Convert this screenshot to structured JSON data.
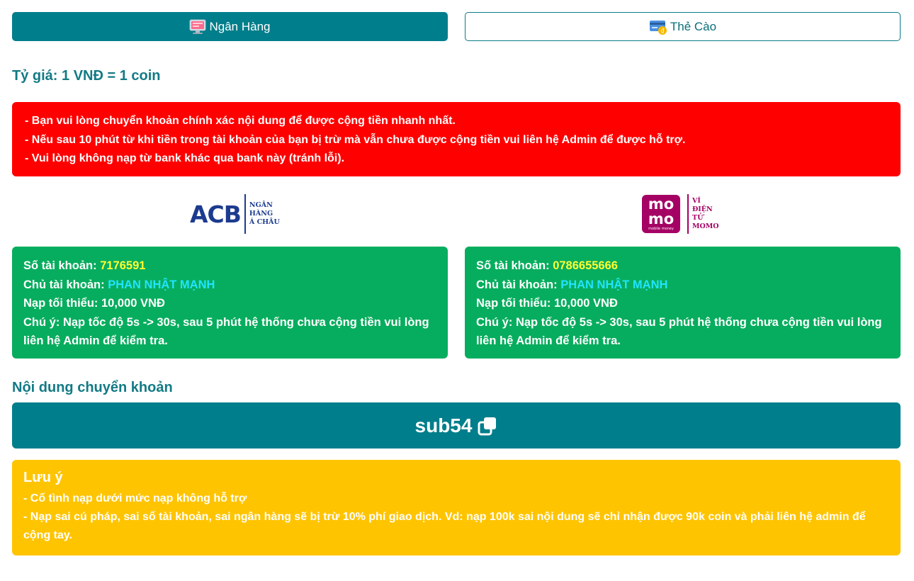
{
  "tabs": {
    "bank_label": "Ngân Hàng",
    "card_label": "Thẻ Cào"
  },
  "rate_text": "Tỷ giá: 1 VNĐ = 1 coin",
  "warning": {
    "lines": [
      "- Bạn vui lòng chuyển khoản chính xác nội dung để được cộng tiền nhanh nhất.",
      "- Nếu sau 10 phút từ khi tiền trong tài khoản của bạn bị trừ mà vẫn chưa được cộng tiền vui liên hệ Admin để được hỗ trợ.",
      "- Vui lòng không nạp từ bank khác qua bank này (tránh lỗi)."
    ]
  },
  "banks": [
    {
      "logo_word": "ACB",
      "logo_sub": [
        "NGÂN",
        "HÀNG",
        "Á CHÂU"
      ],
      "account_label": "Số tài khoản:",
      "account_number": "7176591",
      "owner_label": "Chủ tài khoản:",
      "owner_name": "PHAN NHẬT MẠNH",
      "min_label": "Nạp tối thiểu:",
      "min_value": "10,000 VNĐ",
      "note_label": "Chú ý:",
      "note_text": "Nạp tốc độ 5s -> 30s, sau 5 phút hệ thống chưa cộng tiền vui lòng liên hệ Admin để kiểm tra."
    },
    {
      "logo_word_top": "mo",
      "logo_word_bottom": "mo",
      "logo_small": "mobile money",
      "logo_sub": [
        "VÍ",
        "ĐIỆN",
        "TỬ",
        "MOMO"
      ],
      "account_label": "Số tài khoản:",
      "account_number": "0786655666",
      "owner_label": "Chủ tài khoản:",
      "owner_name": "PHAN NHẬT MẠNH",
      "min_label": "Nạp tối thiểu:",
      "min_value": "10,000 VNĐ",
      "note_label": "Chú ý:",
      "note_text": "Nạp tốc độ 5s -> 30s, sau 5 phút hệ thống chưa cộng tiền vui lòng liên hệ Admin để kiểm tra."
    }
  ],
  "transfer": {
    "title": "Nội dung chuyển khoản",
    "code": "sub54"
  },
  "notice": {
    "title": "Lưu ý",
    "lines": [
      "- Cố tình nạp dưới mức nạp không hỗ trợ",
      "- Nạp sai cú pháp, sai số tài khoản, sai ngân hàng sẽ bị trừ 10% phí giao dịch. Vd: nạp 100k sai nội dung sẽ chỉ nhận được 90k coin và phải liên hệ admin để cộng tay."
    ]
  },
  "colors": {
    "teal": "#007e8b",
    "red": "#ff0000",
    "green": "#07ad5e",
    "yellow": "#ffc400",
    "acb_blue": "#1c3b8f",
    "momo_pink": "#a50064"
  },
  "icons": [
    "bank-computer-icon",
    "scratch-card-icon",
    "copy-icon"
  ]
}
